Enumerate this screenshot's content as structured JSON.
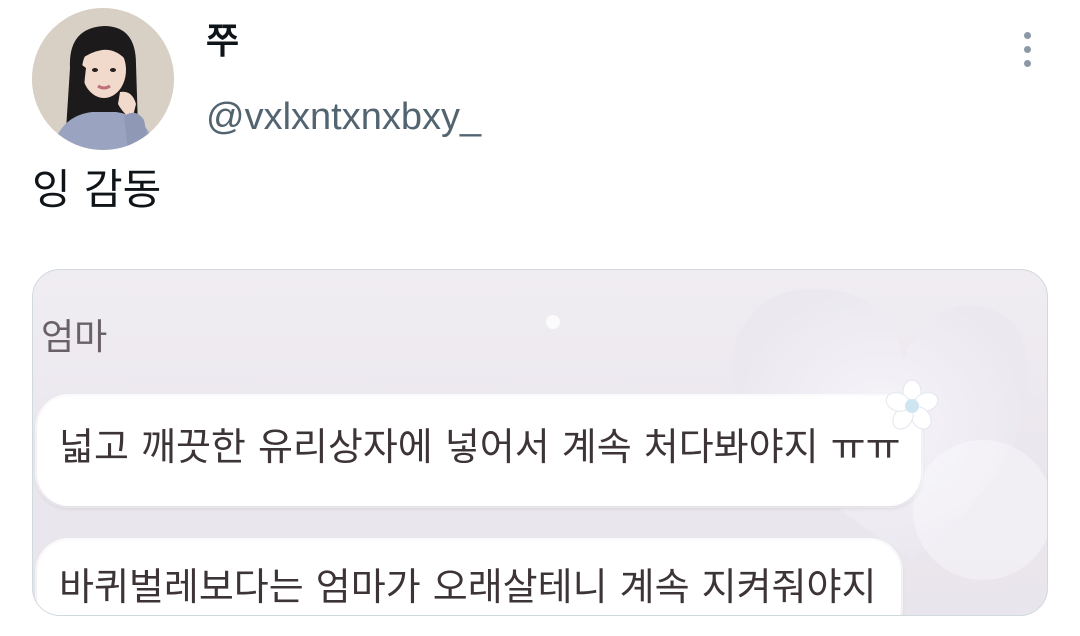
{
  "author": {
    "display_name": "쭈",
    "handle": "@vxlxntxnxbxy_",
    "avatar_icon": "profile-photo"
  },
  "tweet": {
    "text": "잉 감동"
  },
  "more_icon": "ellipsis-vertical-icon",
  "media": {
    "sender": "엄마",
    "messages": [
      "넓고 깨끗한 유리상자에 넣어서 계속 처다봐야지 ㅠㅠ",
      "바퀴벌레보다는 엄마가 오래살테니 계속 지켜줘야지"
    ]
  },
  "colors": {
    "text_primary": "#0f1419",
    "text_secondary": "#536471",
    "border": "#cfd9de",
    "chat_text": "#3d3438"
  }
}
